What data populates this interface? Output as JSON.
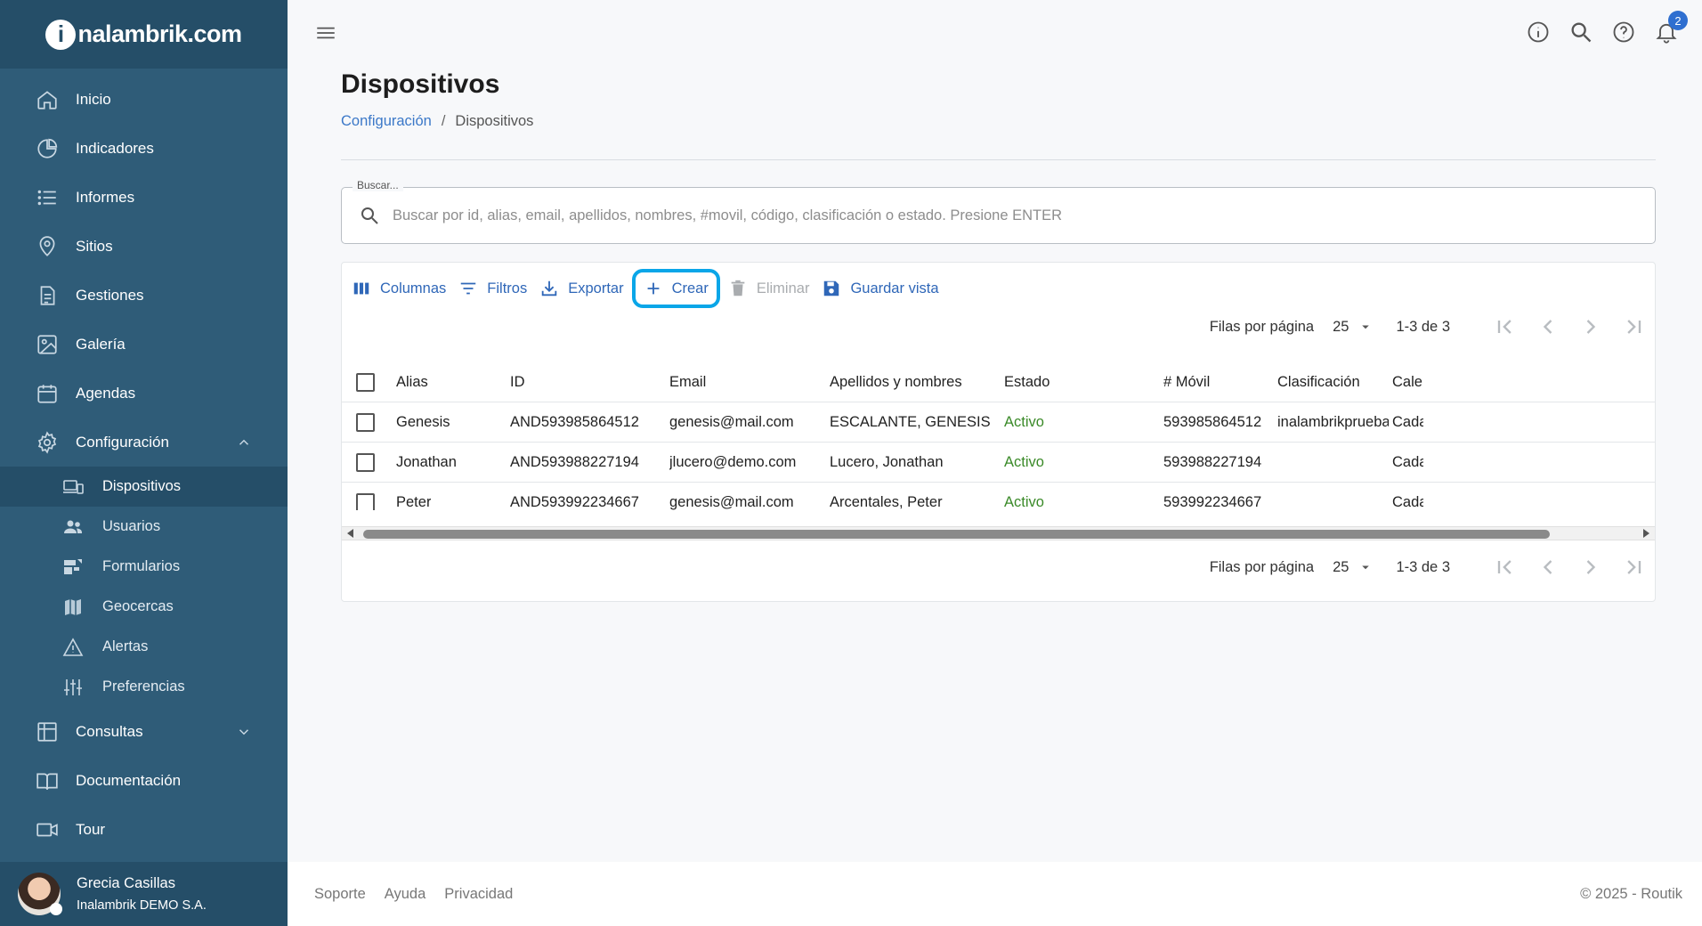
{
  "brand": {
    "logo_letter": "i",
    "logo_text": "nalambrik.com"
  },
  "sidebar": {
    "items": [
      {
        "label": "Inicio",
        "icon": "home-icon"
      },
      {
        "label": "Indicadores",
        "icon": "pie-chart-icon"
      },
      {
        "label": "Informes",
        "icon": "list-icon"
      },
      {
        "label": "Sitios",
        "icon": "location-pin-icon"
      },
      {
        "label": "Gestiones",
        "icon": "document-icon"
      },
      {
        "label": "Galería",
        "icon": "image-icon"
      },
      {
        "label": "Agendas",
        "icon": "calendar-icon"
      },
      {
        "label": "Configuración",
        "icon": "gear-icon",
        "expanded": true
      },
      {
        "label": "Consultas",
        "icon": "table-icon",
        "expanded": false
      },
      {
        "label": "Documentación",
        "icon": "book-icon"
      },
      {
        "label": "Tour",
        "icon": "video-camera-icon"
      }
    ],
    "sub_items": [
      {
        "label": "Dispositivos",
        "icon": "devices-icon",
        "active": true
      },
      {
        "label": "Usuarios",
        "icon": "users-icon"
      },
      {
        "label": "Formularios",
        "icon": "forms-icon"
      },
      {
        "label": "Geocercas",
        "icon": "map-icon"
      },
      {
        "label": "Alertas",
        "icon": "warning-icon"
      },
      {
        "label": "Preferencias",
        "icon": "sliders-icon"
      }
    ]
  },
  "user": {
    "name": "Grecia Casillas",
    "org": "Inalambrik DEMO S.A."
  },
  "header": {
    "notifications_count": "2"
  },
  "page": {
    "title": "Dispositivos",
    "breadcrumb_parent": "Configuración",
    "breadcrumb_separator": "/",
    "breadcrumb_current": "Dispositivos"
  },
  "search": {
    "legend": "Buscar...",
    "placeholder": "Buscar por id, alias, email, apellidos, nombres, #movil, código, clasificación o estado. Presione ENTER",
    "value": ""
  },
  "toolbar": {
    "columns": "Columnas",
    "filters": "Filtros",
    "export": "Exportar",
    "create": "Crear",
    "delete": "Eliminar",
    "save_view": "Guardar vista"
  },
  "pager": {
    "rows_label": "Filas por página",
    "rows_value": "25",
    "range": "1-3 de 3"
  },
  "table": {
    "columns": [
      "Alias",
      "ID",
      "Email",
      "Apellidos y nombres",
      "Estado",
      "# Móvil",
      "Clasificación",
      "Calendario"
    ],
    "rows": [
      [
        "Genesis",
        "AND593985864512",
        "genesis@mail.com",
        "ESCALANTE, GENESIS",
        "Activo",
        "593985864512",
        "inalambrikprueba",
        "Cada"
      ],
      [
        "Jonathan",
        "AND593988227194",
        "jlucero@demo.com",
        "Lucero, Jonathan",
        "Activo",
        "593988227194",
        "",
        "Cada"
      ],
      [
        "Peter",
        "AND593992234667",
        "genesis@mail.com",
        "Arcentales, Peter",
        "Activo",
        "593992234667",
        "",
        "Cada"
      ]
    ]
  },
  "footer": {
    "links": [
      "Soporte",
      "Ayuda",
      "Privacidad"
    ],
    "copyright": "© 2025 - Routik"
  },
  "colors": {
    "sidebar": "#2f5c78",
    "sidebar_dark": "#254e68",
    "accent": "#2f67b8",
    "highlight": "#0aa6e8",
    "status_active": "#3a8a28"
  }
}
